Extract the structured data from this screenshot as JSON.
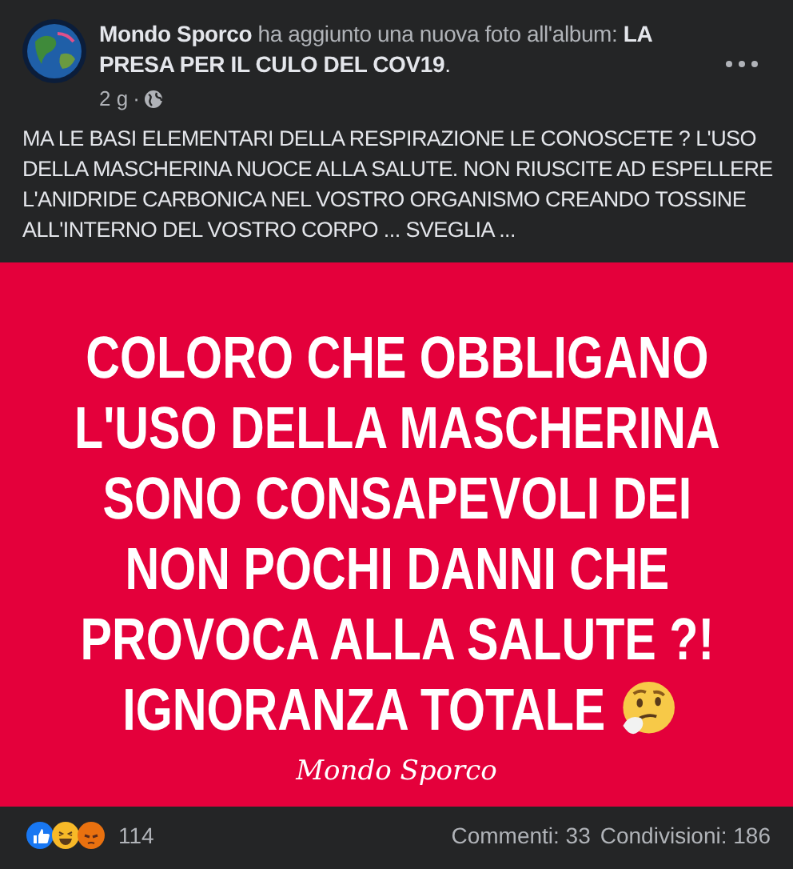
{
  "post": {
    "author": "Mondo Sporco",
    "action": "ha aggiunto una nuova foto all'album:",
    "album": "LA PRESA PER IL CULO DEL COV19",
    "album_end": ".",
    "time": "2 g",
    "separator": "·",
    "text": "MA LE BASI ELEMENTARI DELLA RESPIRAZIONE LE CONOSCETE ? L'USO DELLA MASCHERINA NUOCE ALLA SALUTE. NON RIUSCITE AD ESPELLERE L'ANIDRIDE CARBONICA NEL VOSTRO ORGANISMO CREANDO TOSSINE ALL'INTERNO DEL VOSTRO CORPO ... SVEGLIA ..."
  },
  "image": {
    "lines": [
      "COLORO CHE OBBLIGANO",
      "L'USO DELLA MASCHERINA",
      "SONO CONSAPEVOLI DEI",
      "NON POCHI DANNI CHE",
      "PROVOCA ALLA SALUTE ?!",
      "IGNORANZA TOTALE"
    ],
    "signature": "Mondo Sporco"
  },
  "footer": {
    "reactions": [
      {
        "kind": "like"
      },
      {
        "kind": "haha"
      },
      {
        "kind": "angry"
      }
    ],
    "reaction_count": "114",
    "comments": "Commenti: 33",
    "shares": "Condivisioni: 186"
  }
}
